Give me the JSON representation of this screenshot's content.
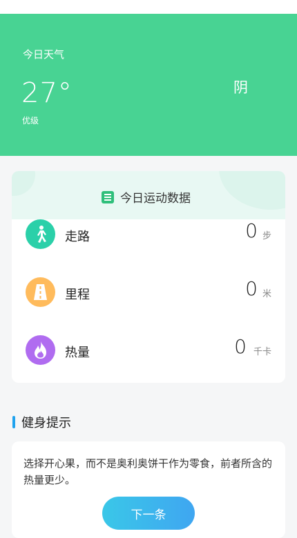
{
  "weather": {
    "label": "今日天气",
    "temperature": "27°",
    "condition": "阴",
    "air_quality": "优级"
  },
  "exercise": {
    "title": "今日运动数据",
    "items": [
      {
        "name": "走路",
        "value": "0",
        "unit": "步",
        "icon": "walking-person-icon",
        "color": "#2bd0a9"
      },
      {
        "name": "里程",
        "value": "0",
        "unit": "米",
        "icon": "road-icon",
        "color": "#ffbb5c"
      },
      {
        "name": "热量",
        "value": "0",
        "unit": "千卡",
        "icon": "flame-icon",
        "color": "#b06cf0"
      }
    ]
  },
  "fitness": {
    "section_title": "健身提示",
    "tip": "选择开心果，而不是奥利奥饼干作为零食，前者所含的热量更少。",
    "next_label": "下一条"
  },
  "colors": {
    "weather_bg": "#48d393",
    "accent_blue": "#1fa2ee"
  }
}
